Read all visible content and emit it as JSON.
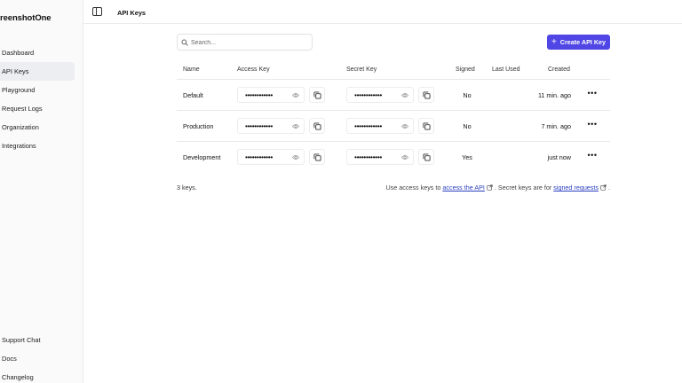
{
  "app": {
    "logo_text": "reenshotOne"
  },
  "sidebar": {
    "top_items": [
      {
        "label": "Dashboard"
      },
      {
        "label": "API Keys",
        "active": true
      },
      {
        "label": "Playground"
      },
      {
        "label": "Request Logs"
      },
      {
        "label": "Organization"
      },
      {
        "label": "Integrations"
      }
    ],
    "bottom_items": [
      {
        "label": "Support Chat"
      },
      {
        "label": "Docs"
      },
      {
        "label": "Changelog"
      }
    ]
  },
  "header": {
    "title": "API Keys",
    "toggle_icon": "sidebar-toggle-icon"
  },
  "toolbar": {
    "search_placeholder": "Search...",
    "search_value": "",
    "create_label": "Create API Key",
    "accent_color": "#4f46e5"
  },
  "table": {
    "columns": [
      "Name",
      "Access Key",
      "Secret Key",
      "Signed",
      "Last Used",
      "Created"
    ],
    "rows": [
      {
        "name": "Default",
        "access_key": "••••••••••••",
        "secret_key": "••••••••••••",
        "signed": "No",
        "last_used": "",
        "created": "11 min. ago"
      },
      {
        "name": "Production",
        "access_key": "••••••••••••",
        "secret_key": "••••••••••••",
        "signed": "No",
        "last_used": "",
        "created": "7 min. ago"
      },
      {
        "name": "Development",
        "access_key": "••••••••••••",
        "secret_key": "••••••••••••",
        "signed": "Yes",
        "last_used": "",
        "created": "just now"
      }
    ]
  },
  "footer": {
    "count": "3 keys.",
    "note_prefix": "Use access keys to",
    "link1": "access the API",
    "note_middle": ". Secret keys are for",
    "link2": "signed requests",
    "note_suffix": "."
  }
}
